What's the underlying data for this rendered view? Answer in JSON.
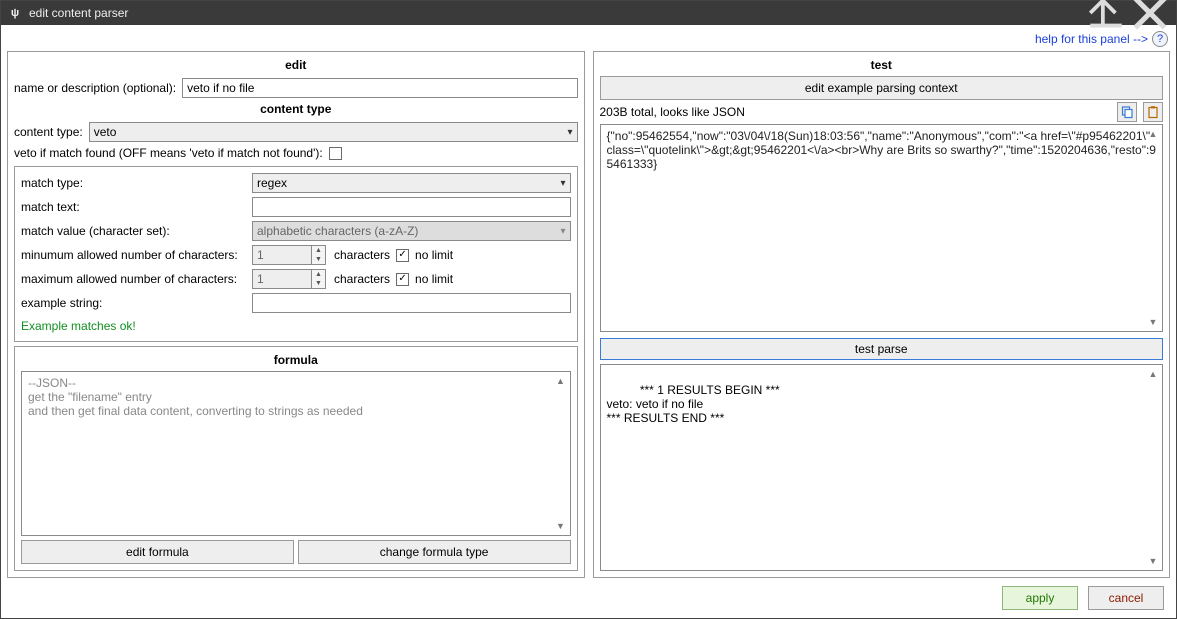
{
  "window": {
    "title": "edit content parser"
  },
  "help": {
    "label": "help for this panel -->"
  },
  "edit": {
    "section_title": "edit",
    "name_label": "name or description (optional):",
    "name_value": "veto if no file",
    "content_type_section_title": "content type",
    "content_type_label": "content type:",
    "content_type_value": "veto",
    "veto_checkbox_label": "veto if match found (OFF means 'veto if match not found'):",
    "veto_checkbox_checked": false,
    "match_type_label": "match type:",
    "match_type_value": "regex",
    "match_text_label": "match text:",
    "match_text_value": "",
    "match_value_label": "match value (character set):",
    "match_value_value": "alphabetic characters (a-zA-Z)",
    "min_chars_label": "minumum allowed number of characters:",
    "min_chars_value": "1",
    "max_chars_label": "maximum allowed number of characters:",
    "max_chars_value": "1",
    "chars_unit": "characters",
    "nolimit_label": "no limit",
    "min_nolimit_checked": true,
    "max_nolimit_checked": true,
    "example_string_label": "example string:",
    "example_string_value": "",
    "example_status": "Example matches ok!",
    "formula_section_title": "formula",
    "formula_text": "--JSON--\nget the \"filename\" entry\nand then get final data content, converting to strings as needed",
    "edit_formula_label": "edit formula",
    "change_formula_label": "change formula type"
  },
  "test": {
    "section_title": "test",
    "edit_context_label": "edit example parsing context",
    "status_text": "203B total, looks like JSON",
    "example_content": "{\"no\":95462554,\"now\":\"03\\/04\\/18(Sun)18:03:56\",\"name\":\"Anonymous\",\"com\":\"<a href=\\\"#p95462201\\\" class=\\\"quotelink\\\">&gt;&gt;95462201<\\/a><br>Why are Brits so swarthy?\",\"time\":1520204636,\"resto\":95461333}",
    "test_parse_label": "test parse",
    "results_text": "*** 1 RESULTS BEGIN ***\nveto: veto if no file\n*** RESULTS END ***"
  },
  "footer": {
    "apply": "apply",
    "cancel": "cancel"
  }
}
